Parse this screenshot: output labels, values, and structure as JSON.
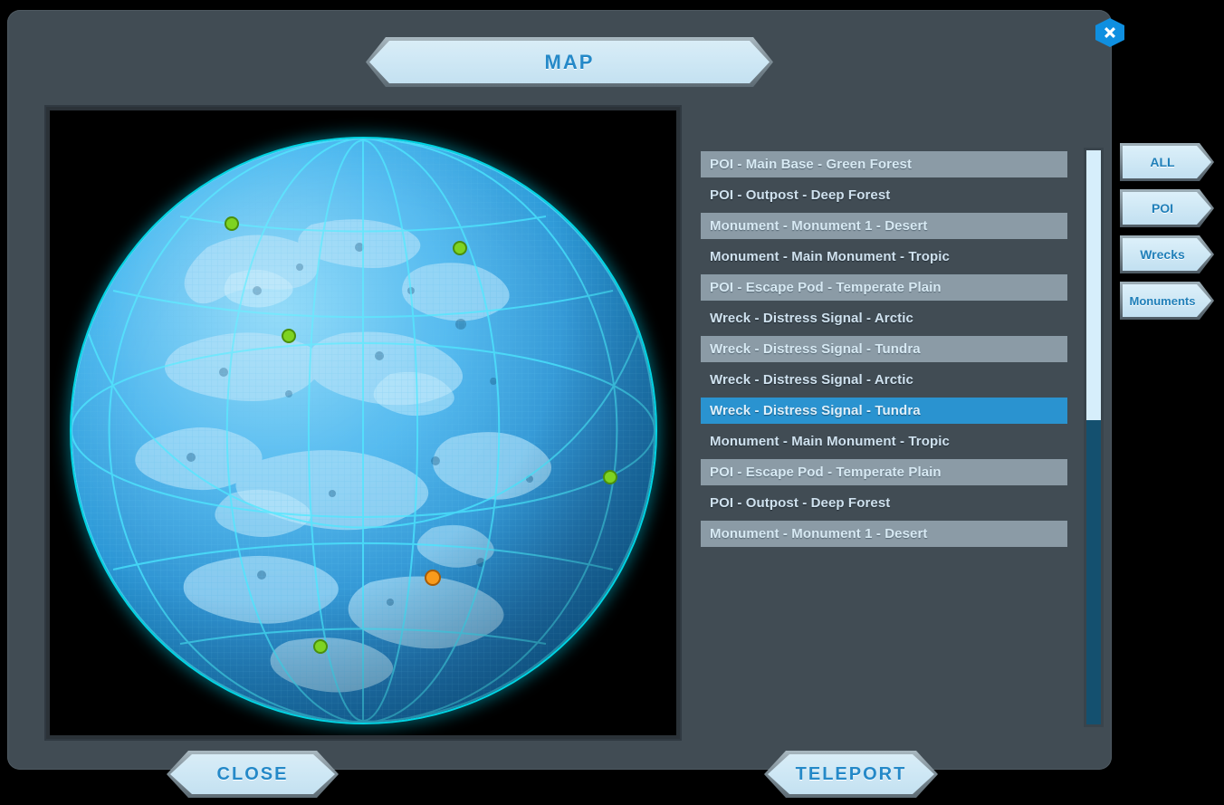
{
  "window": {
    "title": "MAP",
    "close_icon": "close-x-icon"
  },
  "colors": {
    "panel_bg": "#414c54",
    "accent_blue": "#2589c8",
    "selected_row": "#2a93d0",
    "alt_row": "#8b9ba6",
    "plate_fill": "#cfe8f5",
    "marker_green": "#7ed321",
    "marker_orange": "#f89b1c",
    "globe_rim": "#00f0ff",
    "scroll_thumb": "#d6eefb",
    "scroll_track": "#14506f"
  },
  "map": {
    "view_label": "planet-globe",
    "markers": [
      {
        "name": "marker-green-1",
        "type": "green",
        "x": 27.5,
        "y": 14.5
      },
      {
        "name": "marker-green-2",
        "type": "green",
        "x": 66.5,
        "y": 18.8
      },
      {
        "name": "marker-green-3",
        "type": "green",
        "x": 37.2,
        "y": 33.8
      },
      {
        "name": "marker-green-4",
        "type": "green",
        "x": 92.3,
        "y": 58.0
      },
      {
        "name": "marker-orange-selected",
        "type": "orange",
        "x": 61.9,
        "y": 75.2
      },
      {
        "name": "marker-green-5",
        "type": "green",
        "x": 42.6,
        "y": 87.0
      },
      {
        "name": "marker-green-6",
        "type": "green",
        "x": 78.5,
        "y": 101.2
      }
    ]
  },
  "list": {
    "items": [
      {
        "label": "POI - Main Base - Green Forest",
        "style": "alt",
        "selected": false
      },
      {
        "label": "POI - Outpost - Deep Forest",
        "style": "plain",
        "selected": false
      },
      {
        "label": "Monument - Monument 1 - Desert",
        "style": "alt",
        "selected": false
      },
      {
        "label": "Monument - Main Monument - Tropic",
        "style": "plain",
        "selected": false
      },
      {
        "label": "POI - Escape Pod - Temperate Plain",
        "style": "alt",
        "selected": false
      },
      {
        "label": "Wreck - Distress Signal - Arctic",
        "style": "plain",
        "selected": false
      },
      {
        "label": "Wreck - Distress Signal - Tundra",
        "style": "alt",
        "selected": false
      },
      {
        "label": "Wreck - Distress Signal - Arctic",
        "style": "plain",
        "selected": false
      },
      {
        "label": "Wreck - Distress Signal - Tundra",
        "style": "selected",
        "selected": true
      },
      {
        "label": "Monument - Main Monument - Tropic",
        "style": "plain",
        "selected": false
      },
      {
        "label": "POI - Escape Pod - Temperate Plain",
        "style": "alt",
        "selected": false
      },
      {
        "label": "POI - Outpost - Deep Forest",
        "style": "plain",
        "selected": false
      },
      {
        "label": "Monument - Monument 1 - Desert",
        "style": "alt",
        "selected": false
      }
    ]
  },
  "scrollbar": {
    "thumb_top_pct": 0,
    "thumb_height_pct": 47
  },
  "filters": {
    "buttons": [
      {
        "label": "ALL"
      },
      {
        "label": "POI"
      },
      {
        "label": "Wrecks"
      },
      {
        "label": "Monuments"
      }
    ]
  },
  "actions": {
    "close_label": "CLOSE",
    "teleport_label": "TELEPORT"
  }
}
